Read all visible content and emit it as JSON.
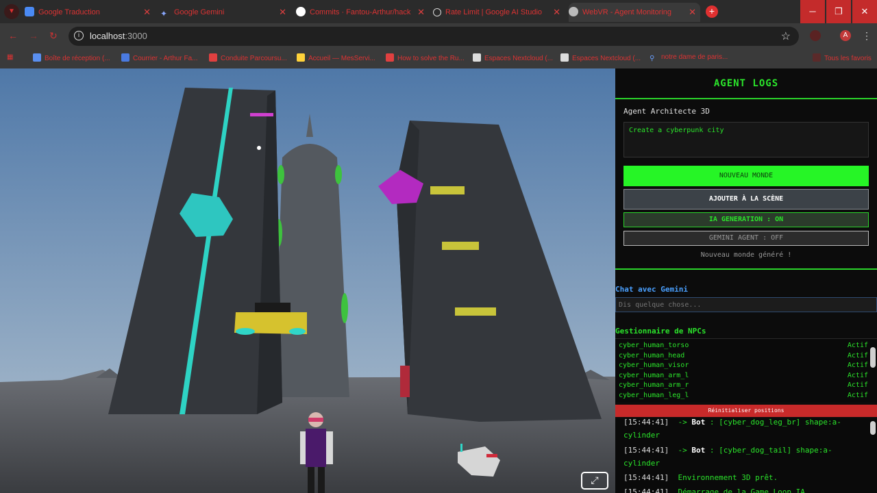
{
  "browser": {
    "tabs": [
      {
        "title": "Google Traduction",
        "icon_color": "#4a8af4"
      },
      {
        "title": "Google Gemini",
        "icon_color": "#8aa8ff"
      },
      {
        "title": "Commits · Fantou-Arthur/hack",
        "icon_color": "#ffffff"
      },
      {
        "title": "Rate Limit | Google AI Studio",
        "icon_color": "#dddddd"
      },
      {
        "title": "WebVR - Agent Monitoring",
        "icon_color": "#bbbbbb"
      }
    ],
    "url_host": "localhost",
    "url_port": ":3000",
    "profile_initial": "A",
    "bookmarks": [
      "Boîte de réception (...",
      "Courrier - Arthur Fa...",
      "Conduite Parcoursu...",
      "Accueil — MesServi...",
      "How to solve the Ru...",
      "Espaces Nextcloud (...",
      "Espaces Nextcloud (...",
      "notre dame de paris..."
    ],
    "bookmarks_all": "Tous les favoris",
    "accent_color": "#e03030"
  },
  "panel": {
    "title": "AGENT LOGS",
    "agent_label": "Agent Architecte 3D",
    "prompt_value": "Create a cyberpunk city",
    "btn_new_world": "NOUVEAU MONDE",
    "btn_add_scene": "AJOUTER À LA SCÈNE",
    "btn_ia_generation": "IA GENERATION : ON",
    "btn_gemini_agent": "GEMINI AGENT : OFF",
    "status": "Nouveau monde généré !",
    "chat_label": "Chat avec Gemini",
    "chat_placeholder": "Dis quelque chose...",
    "npc_label": "Gestionnaire de NPCs",
    "npcs": [
      {
        "name": "cyber_human_torso",
        "status": "Actif"
      },
      {
        "name": "cyber_human_head",
        "status": "Actif"
      },
      {
        "name": "cyber_human_visor",
        "status": "Actif"
      },
      {
        "name": "cyber_human_arm_l",
        "status": "Actif"
      },
      {
        "name": "cyber_human_arm_r",
        "status": "Actif"
      },
      {
        "name": "cyber_human_leg_l",
        "status": "Actif"
      }
    ],
    "btn_reset": "Réinitialiser positions",
    "logs": [
      {
        "time": "[15:44:41]",
        "arrow": "-> ",
        "bot": "Bot",
        "text": " : [cyber_dog_leg_br] shape:a-cylinder"
      },
      {
        "time": "[15:44:41]",
        "arrow": "-> ",
        "bot": "Bot",
        "text": " : [cyber_dog_tail] shape:a-cylinder"
      },
      {
        "time": "[15:44:41]",
        "arrow": "",
        "bot": "",
        "text": "Environnement 3D prêt."
      },
      {
        "time": "[15:44:41]",
        "arrow": "",
        "bot": "",
        "text": "Démarrage de la Game Loop IA..."
      }
    ],
    "colors": {
      "green": "#2be52b",
      "bright_green": "#26f526",
      "blue": "#4aa0ff",
      "red": "#c82a2a"
    }
  }
}
